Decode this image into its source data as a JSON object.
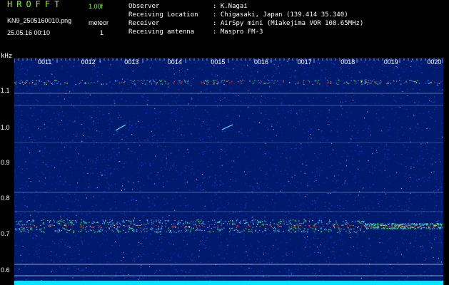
{
  "header": {
    "app_title": "HROFFT",
    "version": "1.00f",
    "filename": "KN9_2505160010.png",
    "mode": "meteor",
    "timestamp": "25.05.16 00:10",
    "mode_value": "1",
    "meta": [
      {
        "key": "Observer",
        "value": ": K.Nagai"
      },
      {
        "key": "Receiving Location",
        "value": ": Chigasaki, Japan (139.414 35.340)"
      },
      {
        "key": "Receiver",
        "value": ": AirSpy mini (Miakejima VOR 108.65MHz)"
      },
      {
        "key": "Receiving antenna",
        "value": ": Maspro FM-3"
      }
    ]
  },
  "chart_data": {
    "type": "heatmap",
    "ylabel": "kHz",
    "y_ticks": [
      "1.1",
      "1.0",
      "0.9",
      "0.8",
      "0.7",
      "0.6"
    ],
    "x_ticks": [
      "0011",
      "0012",
      "0013",
      "0014",
      "0015",
      "0016",
      "0017",
      "0018",
      "0019",
      "0020"
    ],
    "colors": {
      "background": "#001a6e",
      "noise": "#1e50ff",
      "band_core": "#ff3030",
      "band_edge": "#30ff60",
      "grid": "#ffffff",
      "baseline": "#00e5ff"
    }
  }
}
